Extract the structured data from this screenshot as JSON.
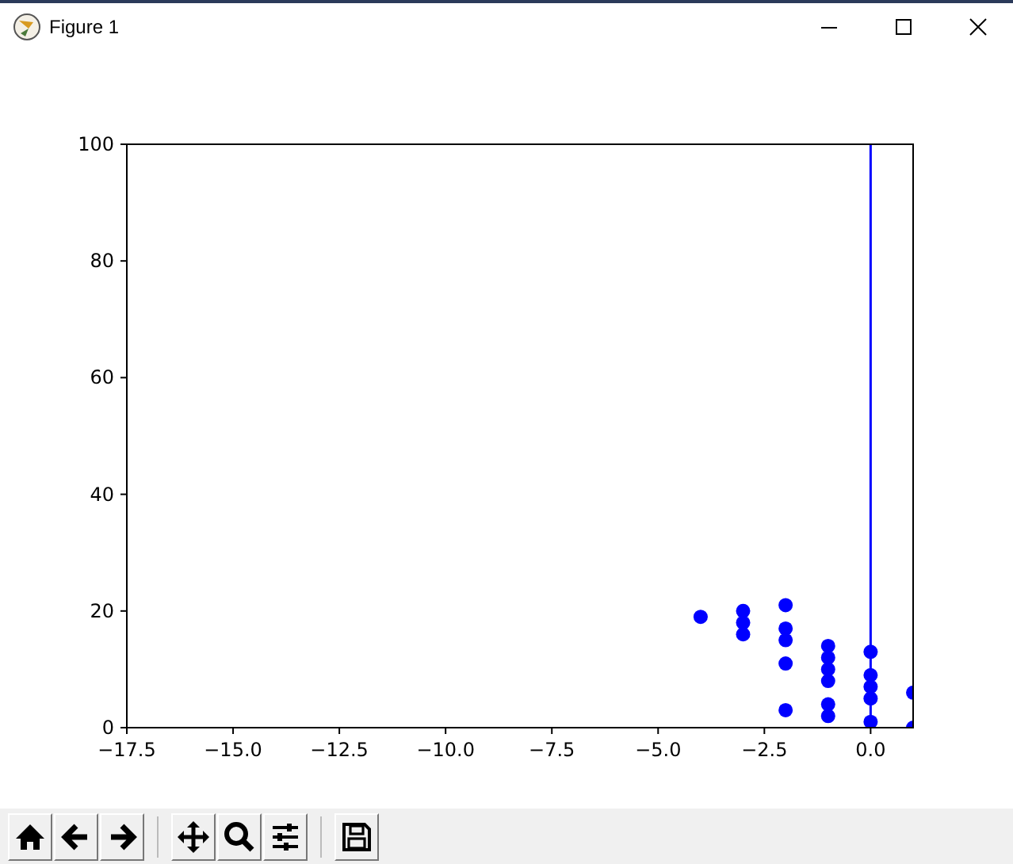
{
  "window": {
    "title": "Figure 1"
  },
  "figure": {
    "chart_data": {
      "type": "scatter",
      "xlim": [
        -17.5,
        1
      ],
      "ylim": [
        0,
        100
      ],
      "xticks": [
        {
          "value": -17.5,
          "label": "−17.5"
        },
        {
          "value": -15,
          "label": "−15.0"
        },
        {
          "value": -12.5,
          "label": "−12.5"
        },
        {
          "value": -10,
          "label": "−10.0"
        },
        {
          "value": -7.5,
          "label": "−7.5"
        },
        {
          "value": -5,
          "label": "−5.0"
        },
        {
          "value": -2.5,
          "label": "−2.5"
        },
        {
          "value": 0,
          "label": "0.0"
        }
      ],
      "yticks": [
        0,
        20,
        40,
        60,
        80,
        100
      ],
      "series": [
        {
          "color": "#0000ff",
          "x": [
            -4,
            -3,
            -3,
            -3,
            -2,
            -2,
            -2,
            -2,
            -2,
            -1,
            -1,
            -1,
            -1,
            -1,
            -1,
            0,
            0,
            0,
            0,
            0,
            1,
            1
          ],
          "values": [
            19,
            20,
            18,
            16,
            21,
            17,
            15,
            11,
            3,
            14,
            12,
            10,
            8,
            4,
            2,
            13,
            9,
            7,
            5,
            1,
            6,
            0
          ]
        }
      ],
      "ref_lines": [
        {
          "axis": "x",
          "value": 0,
          "color": "#0000ff"
        }
      ]
    }
  },
  "toolbar": [
    {
      "kind": "home"
    },
    {
      "kind": "back"
    },
    {
      "kind": "forward"
    },
    {
      "kind": "separator"
    },
    {
      "kind": "pan"
    },
    {
      "kind": "zoom"
    },
    {
      "kind": "configure"
    },
    {
      "kind": "separator"
    },
    {
      "kind": "save"
    }
  ]
}
